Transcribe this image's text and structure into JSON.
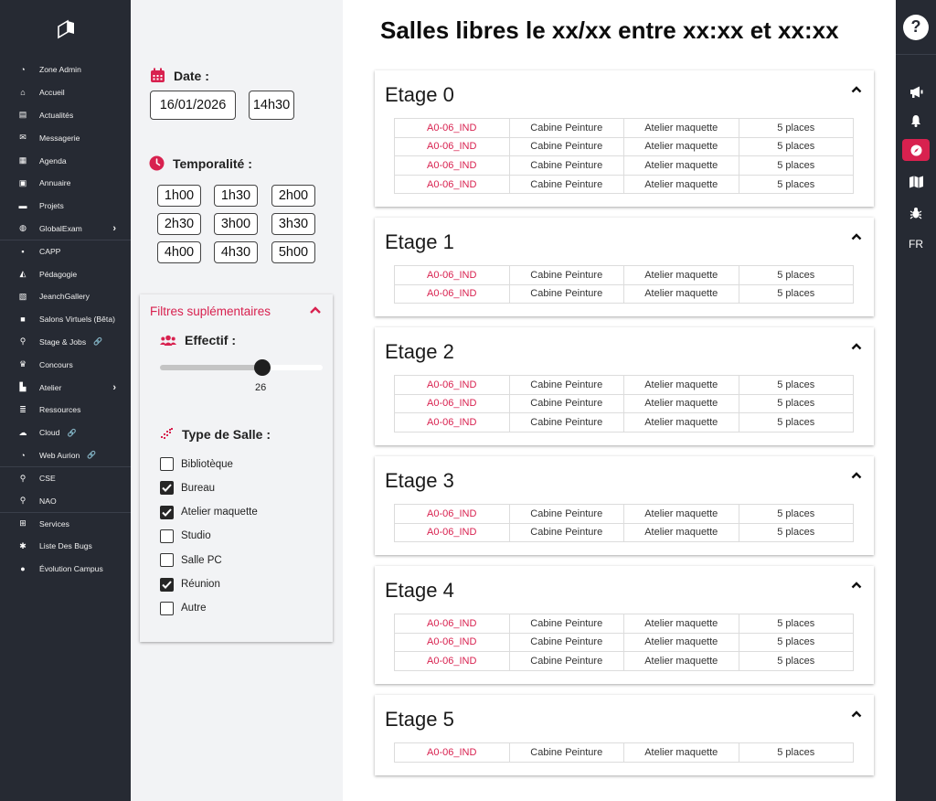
{
  "sidebar": {
    "items": [
      {
        "label": "Zone Admin",
        "icon": "gauge-icon"
      },
      {
        "label": "Accueil",
        "icon": "home-icon"
      },
      {
        "label": "Actualités",
        "icon": "newspaper-icon"
      },
      {
        "label": "Messagerie",
        "icon": "envelope-icon"
      },
      {
        "label": "Agenda",
        "icon": "calendar-icon"
      },
      {
        "label": "Annuaire",
        "icon": "address-book-icon"
      },
      {
        "label": "Projets",
        "icon": "folder-icon"
      },
      {
        "label": "GlobalExam",
        "icon": "globe-icon",
        "chevron": "›"
      },
      {
        "label": "CAPP",
        "icon": "note-icon"
      },
      {
        "label": "Pédagogie",
        "icon": "graduation-cap-icon"
      },
      {
        "label": "JeanchGallery",
        "icon": "images-icon"
      },
      {
        "label": "Salons Virtuels (Bêta)",
        "icon": "video-icon"
      },
      {
        "label": "Stage & Jobs",
        "icon": "search-icon",
        "link": "🔗"
      },
      {
        "label": "Concours",
        "icon": "trophy-icon"
      },
      {
        "label": "Atelier",
        "icon": "chart-icon",
        "chevron": "›"
      },
      {
        "label": "Ressources",
        "icon": "database-icon"
      },
      {
        "label": "Cloud",
        "icon": "cloud-icon",
        "link": "🔗"
      },
      {
        "label": "Web Aurion",
        "icon": "gauge-icon",
        "link": "🔗"
      },
      {
        "label": "CSE",
        "icon": "pin-icon"
      },
      {
        "label": "NAO",
        "icon": "pin-icon"
      },
      {
        "label": "Services",
        "icon": "plus-square-icon"
      },
      {
        "label": "Liste Des Bugs",
        "icon": "bugs-icon"
      },
      {
        "label": "Évolution Campus",
        "icon": "lightbulb-icon"
      }
    ]
  },
  "filters": {
    "date_label": "Date :",
    "date_value": "16/01/2026",
    "time_value": "14h30",
    "temporalite_label": "Temporalité :",
    "durations": [
      "1h00",
      "1h30",
      "2h00",
      "2h30",
      "3h00",
      "3h30",
      "4h00",
      "4h30",
      "5h00"
    ],
    "extra_title": "Filtres suplémentaires",
    "effectif_label": "Effectif :",
    "effectif_value": "26",
    "effectif_fraction": 0.63,
    "type_label": "Type de Salle :",
    "types": [
      {
        "label": "Bibliotèque",
        "checked": false
      },
      {
        "label": "Bureau",
        "checked": true
      },
      {
        "label": "Atelier maquette",
        "checked": true
      },
      {
        "label": "Studio",
        "checked": false
      },
      {
        "label": "Salle PC",
        "checked": false
      },
      {
        "label": "Réunion",
        "checked": true
      },
      {
        "label": "Autre",
        "checked": false
      }
    ]
  },
  "main": {
    "title": "Salles libres le xx/xx entre xx:xx et xx:xx",
    "floors": [
      {
        "title": "Etage 0",
        "rows": [
          [
            "A0-06_IND",
            "Cabine Peinture",
            "Atelier maquette",
            "5 places"
          ],
          [
            "A0-06_IND",
            "Cabine Peinture",
            "Atelier maquette",
            "5 places"
          ],
          [
            "A0-06_IND",
            "Cabine Peinture",
            "Atelier maquette",
            "5 places"
          ],
          [
            "A0-06_IND",
            "Cabine Peinture",
            "Atelier maquette",
            "5 places"
          ]
        ]
      },
      {
        "title": "Etage 1",
        "rows": [
          [
            "A0-06_IND",
            "Cabine Peinture",
            "Atelier maquette",
            "5 places"
          ],
          [
            "A0-06_IND",
            "Cabine Peinture",
            "Atelier maquette",
            "5 places"
          ]
        ]
      },
      {
        "title": "Etage 2",
        "rows": [
          [
            "A0-06_IND",
            "Cabine Peinture",
            "Atelier maquette",
            "5 places"
          ],
          [
            "A0-06_IND",
            "Cabine Peinture",
            "Atelier maquette",
            "5 places"
          ],
          [
            "A0-06_IND",
            "Cabine Peinture",
            "Atelier maquette",
            "5 places"
          ]
        ]
      },
      {
        "title": "Etage 3",
        "rows": [
          [
            "A0-06_IND",
            "Cabine Peinture",
            "Atelier maquette",
            "5 places"
          ],
          [
            "A0-06_IND",
            "Cabine Peinture",
            "Atelier maquette",
            "5 places"
          ]
        ]
      },
      {
        "title": "Etage 4",
        "rows": [
          [
            "A0-06_IND",
            "Cabine Peinture",
            "Atelier maquette",
            "5 places"
          ],
          [
            "A0-06_IND",
            "Cabine Peinture",
            "Atelier maquette",
            "5 places"
          ],
          [
            "A0-06_IND",
            "Cabine Peinture",
            "Atelier maquette",
            "5 places"
          ]
        ]
      },
      {
        "title": "Etage 5",
        "rows": [
          [
            "A0-06_IND",
            "Cabine Peinture",
            "Atelier maquette",
            "5 places"
          ]
        ]
      }
    ]
  },
  "rail": {
    "help": "?",
    "items": [
      "megaphone-icon",
      "bell-icon",
      "compass-icon",
      "map-icon",
      "bug-icon"
    ],
    "lang": "FR"
  },
  "colors": {
    "accent": "#d8214f",
    "sidebar_bg": "#262a33"
  }
}
